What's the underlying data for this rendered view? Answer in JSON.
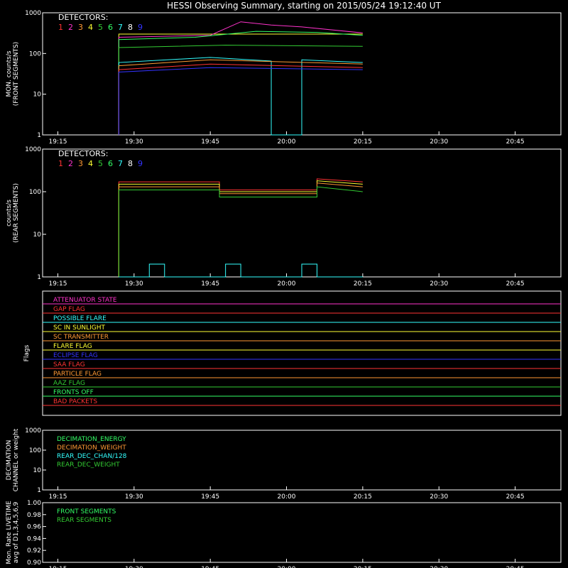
{
  "title": "HESSI Observing Summary, starting on 2015/05/24 19:12:40 UT",
  "time_ticks": [
    "19:15",
    "19:30",
    "19:45",
    "20:00",
    "20:15",
    "20:30",
    "20:45"
  ],
  "colors": {
    "axis": "#ffffff",
    "d1": "#ff3333",
    "d2": "#ff33cc",
    "d3": "#ff9933",
    "d4": "#ffff33",
    "d5": "#33cc33",
    "d6": "#33ff66",
    "d7": "#33ffff",
    "d8": "#ffffff",
    "d9": "#3333ff"
  },
  "detectors_label": "DETECTORS:",
  "detector_numbers": [
    "1",
    "2",
    "3",
    "4",
    "5",
    "6",
    "7",
    "8",
    "9"
  ],
  "chart_data": [
    {
      "id": "front",
      "type": "line",
      "ylabel_lines": [
        "MON. counts/s",
        "(FRONT SEGMENTS)"
      ],
      "yscale": "log",
      "ylim": [
        1,
        1000
      ],
      "ytick_labels": [
        "1",
        "10",
        "100",
        "1000"
      ],
      "grid": false,
      "series": [
        {
          "color": "#ffff33",
          "points": [
            [
              19.45,
              1
            ],
            [
              19.45,
              300
            ],
            [
              20.25,
              300
            ]
          ]
        },
        {
          "color": "#ff33cc",
          "points": [
            [
              19.45,
              1
            ],
            [
              19.45,
              250
            ],
            [
              19.75,
              280
            ],
            [
              19.85,
              600
            ],
            [
              19.95,
              500
            ],
            [
              20.05,
              450
            ],
            [
              20.25,
              320
            ]
          ]
        },
        {
          "color": "#33ff66",
          "points": [
            [
              19.45,
              1
            ],
            [
              19.45,
              220
            ],
            [
              19.7,
              250
            ],
            [
              19.9,
              350
            ],
            [
              20.1,
              330
            ],
            [
              20.25,
              280
            ]
          ]
        },
        {
          "color": "#33cc33",
          "points": [
            [
              19.45,
              1
            ],
            [
              19.45,
              140
            ],
            [
              19.8,
              160
            ],
            [
              20.25,
              150
            ]
          ]
        },
        {
          "color": "#33ffff",
          "points": [
            [
              19.45,
              1
            ],
            [
              19.45,
              60
            ],
            [
              19.75,
              80
            ],
            [
              19.95,
              65
            ],
            [
              19.95,
              1
            ],
            [
              20.05,
              1
            ],
            [
              20.05,
              70
            ],
            [
              20.25,
              60
            ]
          ]
        },
        {
          "color": "#ff9933",
          "points": [
            [
              19.45,
              1
            ],
            [
              19.45,
              50
            ],
            [
              19.75,
              70
            ],
            [
              20.25,
              55
            ]
          ]
        },
        {
          "color": "#ff3333",
          "points": [
            [
              19.45,
              1
            ],
            [
              19.45,
              40
            ],
            [
              19.75,
              55
            ],
            [
              20.25,
              45
            ]
          ]
        },
        {
          "color": "#3333ff",
          "points": [
            [
              19.45,
              1
            ],
            [
              19.45,
              35
            ],
            [
              19.75,
              45
            ],
            [
              20.25,
              40
            ]
          ]
        }
      ]
    },
    {
      "id": "rear",
      "type": "line",
      "ylabel_lines": [
        "counts/s",
        "(REAR SEGMENTS)"
      ],
      "yscale": "log",
      "ylim": [
        1,
        1000
      ],
      "ytick_labels": [
        "1",
        "10",
        "100",
        "1000"
      ],
      "grid": false,
      "series": [
        {
          "color": "#ff3333",
          "points": [
            [
              19.45,
              1
            ],
            [
              19.45,
              170
            ],
            [
              19.78,
              170
            ],
            [
              19.78,
              110
            ],
            [
              20.1,
              110
            ],
            [
              20.1,
              200
            ],
            [
              20.25,
              170
            ]
          ]
        },
        {
          "color": "#ffff33",
          "points": [
            [
              19.45,
              1
            ],
            [
              19.45,
              150
            ],
            [
              19.78,
              150
            ],
            [
              19.78,
              100
            ],
            [
              20.1,
              100
            ],
            [
              20.1,
              180
            ],
            [
              20.25,
              150
            ]
          ]
        },
        {
          "color": "#ff9933",
          "points": [
            [
              19.45,
              1
            ],
            [
              19.45,
              130
            ],
            [
              19.78,
              130
            ],
            [
              19.78,
              90
            ],
            [
              20.1,
              90
            ],
            [
              20.1,
              160
            ],
            [
              20.25,
              130
            ]
          ]
        },
        {
          "color": "#33cc33",
          "points": [
            [
              19.45,
              1
            ],
            [
              19.45,
              110
            ],
            [
              19.78,
              110
            ],
            [
              19.78,
              75
            ],
            [
              20.1,
              75
            ],
            [
              20.1,
              130
            ],
            [
              20.25,
              100
            ]
          ]
        },
        {
          "color": "#33ffff",
          "points": [
            [
              19.45,
              1
            ],
            [
              19.55,
              1
            ],
            [
              19.55,
              2
            ],
            [
              19.6,
              2
            ],
            [
              19.6,
              1
            ],
            [
              19.8,
              1
            ],
            [
              19.8,
              2
            ],
            [
              19.85,
              2
            ],
            [
              19.85,
              1
            ],
            [
              20.05,
              1
            ],
            [
              20.05,
              2
            ],
            [
              20.1,
              2
            ],
            [
              20.1,
              1
            ],
            [
              20.25,
              1
            ]
          ]
        }
      ]
    },
    {
      "id": "flags",
      "type": "line",
      "ylabel": "Flags",
      "flags": [
        {
          "name": "ATTENUATOR STATE",
          "color": "#ff33cc"
        },
        {
          "name": "GAP FLAG",
          "color": "#ff3333"
        },
        {
          "name": "POSSIBLE FLARE",
          "color": "#33ffff"
        },
        {
          "name": "SC IN SUNLIGHT",
          "color": "#ffff33"
        },
        {
          "name": "SC TRANSMITTER",
          "color": "#ff9933"
        },
        {
          "name": "FLARE FLAG",
          "color": "#ffff33"
        },
        {
          "name": "ECLIPSE FLAG",
          "color": "#3333ff"
        },
        {
          "name": "SAA FLAG",
          "color": "#ff3333"
        },
        {
          "name": "PARTICLE FLAG",
          "color": "#ff9933"
        },
        {
          "name": "AAZ FLAG",
          "color": "#33cc33"
        },
        {
          "name": "FRONTS OFF",
          "color": "#33ff66"
        },
        {
          "name": "BAD PACKETS",
          "color": "#ff3333"
        }
      ]
    },
    {
      "id": "decimation",
      "type": "line",
      "ylabel_lines": [
        "DECIMATION",
        "CHANNEL or weight"
      ],
      "yscale": "log",
      "ylim": [
        1,
        1000
      ],
      "ytick_labels": [
        "1",
        "10",
        "100",
        "1000"
      ],
      "legend": [
        {
          "name": "DECIMATION_ENERGY",
          "color": "#33ff66"
        },
        {
          "name": "DECIMATION_WEIGHT",
          "color": "#ff9933"
        },
        {
          "name": "REAR_DEC_CHAN/128",
          "color": "#33ffff"
        },
        {
          "name": "REAR_DEC_WEIGHT",
          "color": "#33cc33"
        }
      ]
    },
    {
      "id": "livetime",
      "type": "line",
      "ylabel_lines": [
        "Mon. Rate LIVETIME",
        "avg of D1,3,4,5,6,9"
      ],
      "ylim": [
        0.9,
        1.0
      ],
      "ytick_labels": [
        "0.90",
        "0.92",
        "0.94",
        "0.96",
        "0.98",
        "1.00"
      ],
      "legend": [
        {
          "name": "FRONT SEGMENTS",
          "color": "#33ff66"
        },
        {
          "name": "REAR SEGMENTS",
          "color": "#33cc33"
        }
      ]
    }
  ]
}
